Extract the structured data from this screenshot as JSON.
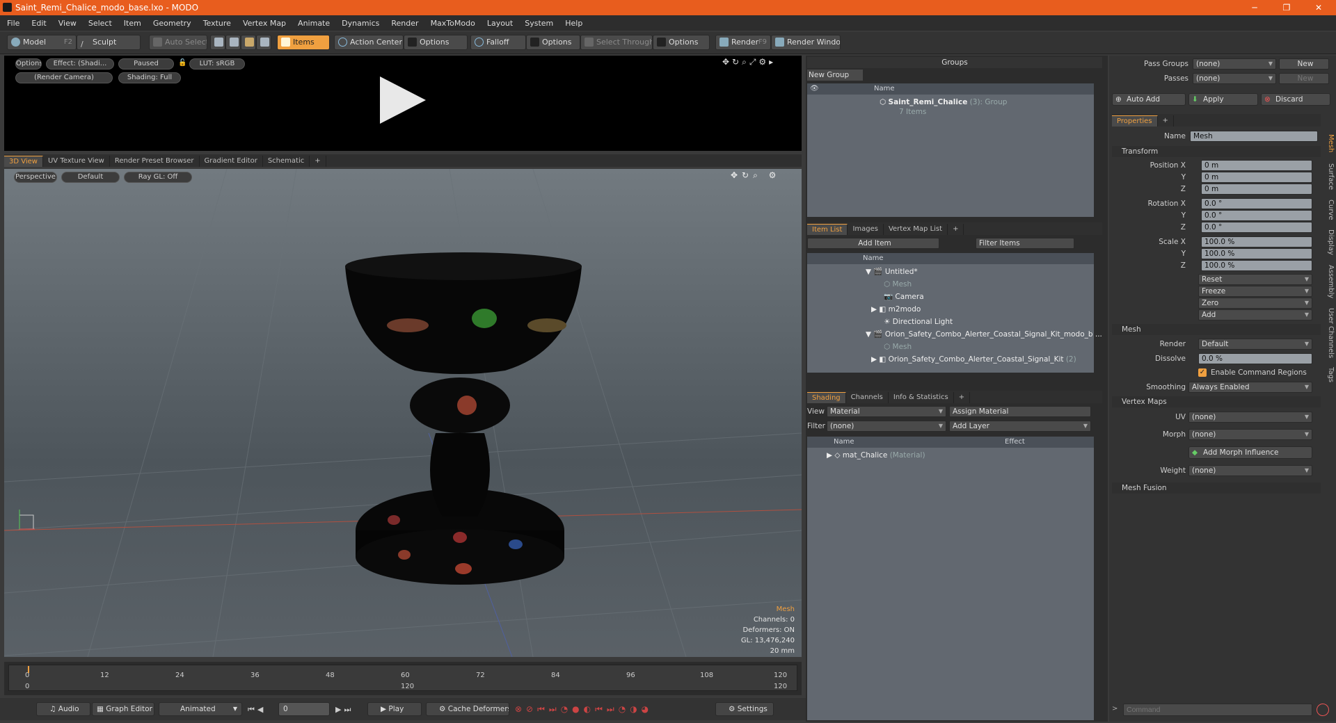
{
  "window": {
    "title": "Saint_Remi_Chalice_modo_base.lxo - MODO",
    "minimize": "─",
    "maximize": "❐",
    "close": "✕"
  },
  "menu": [
    "File",
    "Edit",
    "View",
    "Select",
    "Item",
    "Geometry",
    "Texture",
    "Vertex Map",
    "Animate",
    "Dynamics",
    "Render",
    "MaxToModo",
    "Layout",
    "System",
    "Help"
  ],
  "toolbar": {
    "model": "Model",
    "model_key": "F2",
    "sculpt": "Sculpt",
    "auto_select": "Auto Select",
    "items": "Items",
    "action_center": "Action Center",
    "options1": "Options",
    "falloff": "Falloff",
    "options2": "Options",
    "select_through": "Select Through",
    "options3": "Options",
    "render": "Render",
    "render_key": "F9",
    "render_window": "Render Window"
  },
  "render_preview": {
    "options": "Options",
    "effect": "Effect: (Shadi...",
    "paused": "Paused",
    "lut": "LUT: sRGB",
    "camera": "(Render Camera)",
    "shading": "Shading: Full"
  },
  "view_tabs": [
    "3D View",
    "UV Texture View",
    "Render Preset Browser",
    "Gradient Editor",
    "Schematic",
    "+"
  ],
  "viewport": {
    "perspective": "Perspective",
    "default": "Default",
    "raygl": "Ray GL: Off",
    "info_title": "Mesh",
    "info_channels": "Channels: 0",
    "info_deformers": "Deformers: ON",
    "info_gl": "GL: 13,476,240",
    "info_size": "20 mm"
  },
  "timeline": {
    "ticks": [
      "0",
      "12",
      "24",
      "36",
      "48",
      "60",
      "72",
      "84",
      "96",
      "108",
      "120"
    ],
    "start": "0",
    "end_mid": "120",
    "end": "120"
  },
  "bottom": {
    "audio": "Audio",
    "graph_editor": "Graph Editor",
    "animated": "Animated",
    "frame": "0",
    "play": "Play",
    "cache_deformers": "Cache Deformers",
    "settings": "Settings"
  },
  "groups": {
    "title": "Groups",
    "new_group": "New Group",
    "col_name": "Name",
    "group_name": "Saint_Remi_Chalice",
    "group_count": "(3)",
    "group_type": ": Group",
    "group_items": "7 Items"
  },
  "itemlist": {
    "tabs": [
      "Item List",
      "Images",
      "Vertex Map List",
      "+"
    ],
    "add_item": "Add Item",
    "filter_items": "Filter Items",
    "col_name": "Name",
    "rows": [
      {
        "label": "Untitled*",
        "extra": ""
      },
      {
        "label": "Mesh",
        "extra": ""
      },
      {
        "label": "Camera",
        "extra": ""
      },
      {
        "label": "m2modo",
        "extra": ""
      },
      {
        "label": "Directional Light",
        "extra": ""
      },
      {
        "label": "Orion_Safety_Combo_Alerter_Coastal_Signal_Kit_modo_b ...",
        "extra": ""
      },
      {
        "label": "Mesh",
        "extra": ""
      },
      {
        "label": "Orion_Safety_Combo_Alerter_Coastal_Signal_Kit",
        "extra": "(2)"
      }
    ]
  },
  "shading": {
    "tabs": [
      "Shading",
      "Channels",
      "Info & Statistics",
      "+"
    ],
    "view_label": "View",
    "view_value": "Material",
    "assign_material": "Assign Material",
    "filter_label": "Filter",
    "filter_value": "(none)",
    "add_layer": "Add Layer",
    "col_name": "Name",
    "col_effect": "Effect",
    "row_name": "mat_Chalice",
    "row_type": "(Material)"
  },
  "passes": {
    "pass_groups": "Pass Groups",
    "pass_groups_value": "(none)",
    "new1": "New",
    "passes": "Passes",
    "passes_value": "(none)",
    "new2": "New",
    "auto_add": "Auto Add",
    "apply": "Apply",
    "discard": "Discard"
  },
  "properties": {
    "tab": "Properties",
    "plus": "+",
    "name_label": "Name",
    "name_value": "Mesh",
    "transform": "Transform",
    "pos_x_label": "Position X",
    "pos_x": "0 m",
    "pos_y": "0 m",
    "pos_z": "0 m",
    "rot_x_label": "Rotation X",
    "rot_x": "0.0 °",
    "rot_y": "0.0 °",
    "rot_z": "0.0 °",
    "scl_x_label": "Scale X",
    "scl_x": "100.0 %",
    "scl_y": "100.0 %",
    "scl_z": "100.0 %",
    "y": "Y",
    "z": "Z",
    "reset": "Reset",
    "freeze": "Freeze",
    "zero": "Zero",
    "add": "Add",
    "mesh": "Mesh",
    "render_label": "Render",
    "render_value": "Default",
    "dissolve_label": "Dissolve",
    "dissolve_value": "0.0 %",
    "enable_cmd": "Enable Command Regions",
    "smoothing_label": "Smoothing",
    "smoothing_value": "Always Enabled",
    "vertex_maps": "Vertex Maps",
    "uv_label": "UV",
    "uv_value": "(none)",
    "morph_label": "Morph",
    "morph_value": "(none)",
    "add_morph": "Add Morph Influence",
    "weight_label": "Weight",
    "weight_value": "(none)",
    "mesh_fusion": "Mesh Fusion",
    "side_tabs": [
      "Mesh",
      "Surface",
      "Curve",
      "Display",
      "Assembly",
      "User Channels",
      "Tags"
    ]
  },
  "command": {
    "placeholder": "Command"
  },
  "colors": {
    "accent": "#f0a040",
    "titlebar": "#e85d1e"
  }
}
